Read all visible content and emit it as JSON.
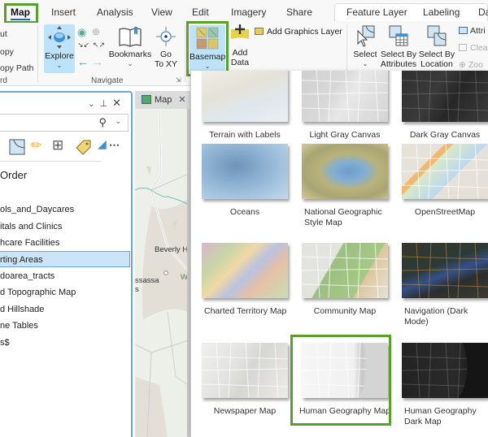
{
  "ribbon_tabs": [
    "Map",
    "Insert",
    "Analysis",
    "View",
    "Edit",
    "Imagery",
    "Share",
    "Feature Layer",
    "Labeling",
    "Da"
  ],
  "active_tab": "Map",
  "clipboard_group": {
    "items": [
      "ut",
      "opy",
      "opy Path"
    ],
    "label": "rd"
  },
  "navigate_group": {
    "explore_label": "Explore",
    "bookmarks_label": "Bookmarks",
    "goto_label_1": "Go",
    "goto_label_2": "To XY",
    "label": "Navigate"
  },
  "layer_group": {
    "basemap_label": "Basemap",
    "add_data_label_1": "Add",
    "add_data_label_2": "Data",
    "add_graphics_layer_label": "Add Graphics Layer"
  },
  "selection_group": {
    "select_label": "Select",
    "select_by_attributes_1": "Select By",
    "select_by_attributes_2": "Attributes",
    "select_by_location_1": "Select By",
    "select_by_location_2": "Location",
    "attributes_label": "Attri",
    "clear_label": "Clea",
    "zoom_label": "Zoo"
  },
  "contents_pane": {
    "search_placeholder": "",
    "order_heading": "Order",
    "layers": [
      "ols_and_Daycares",
      "itals and Clinics",
      "hcare Facilities",
      "rting Areas",
      "doarea_tracts",
      "d Topographic Map",
      "d Hillshade",
      "ne Tables",
      "s$"
    ],
    "selected_layer_index": 3
  },
  "map_view": {
    "tab_label": "Map",
    "labels": [
      "Beverly Hil",
      "ssassa",
      "s",
      "Wi",
      "S"
    ]
  },
  "basemap_gallery": {
    "items": [
      {
        "label": "Terrain with Labels",
        "style": "terrain"
      },
      {
        "label": "Light Gray Canvas",
        "style": "lightgray"
      },
      {
        "label": "Dark Gray Canvas",
        "style": "darkgray"
      },
      {
        "label": "Oceans",
        "style": "oceans"
      },
      {
        "label": "National Geographic Style Map",
        "style": "natgeo"
      },
      {
        "label": "OpenStreetMap",
        "style": "osm"
      },
      {
        "label": "Charted Territory Map",
        "style": "charted"
      },
      {
        "label": "Community Map",
        "style": "community"
      },
      {
        "label": "Navigation (Dark Mode)",
        "style": "navdark"
      },
      {
        "label": "Newspaper Map",
        "style": "newspaper"
      },
      {
        "label": "Human Geography Map",
        "style": "humangeo"
      },
      {
        "label": "Human Geography Dark Map",
        "style": "humangeodark"
      }
    ],
    "highlighted_item": "Human Geography Map"
  },
  "colors": {
    "highlight_green": "#5a9e2b",
    "selected_blue": "#bde3fb",
    "pane_border": "#6aa7dc"
  }
}
